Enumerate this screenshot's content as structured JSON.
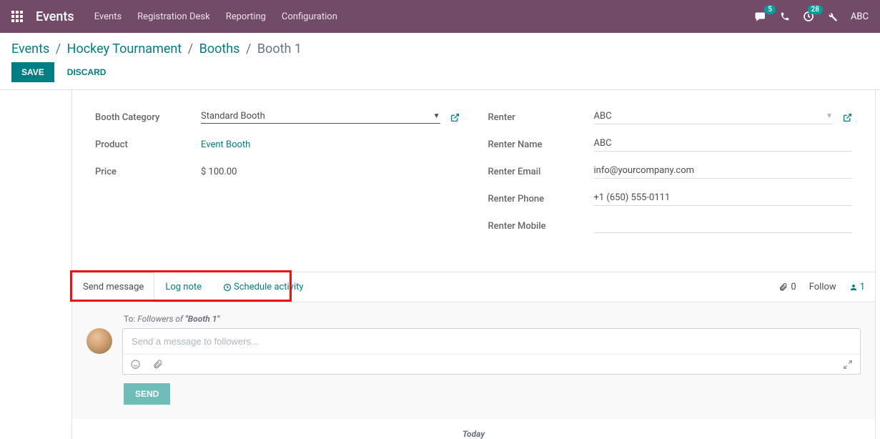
{
  "navbar": {
    "brand": "Events",
    "items": [
      "Events",
      "Registration Desk",
      "Reporting",
      "Configuration"
    ],
    "chat_badge": "5",
    "activity_badge": "28",
    "user": "ABC"
  },
  "breadcrumb": {
    "root": "Events",
    "event": "Hockey Tournament",
    "section": "Booths",
    "current": "Booth 1"
  },
  "actions": {
    "save": "SAVE",
    "discard": "DISCARD"
  },
  "form": {
    "left": {
      "booth_category_label": "Booth Category",
      "booth_category_value": "Standard Booth",
      "product_label": "Product",
      "product_value": "Event Booth",
      "price_label": "Price",
      "price_value": "$ 100.00"
    },
    "right": {
      "renter_label": "Renter",
      "renter_value": "ABC",
      "renter_name_label": "Renter Name",
      "renter_name_value": "ABC",
      "renter_email_label": "Renter Email",
      "renter_email_value": "info@yourcompany.com",
      "renter_phone_label": "Renter Phone",
      "renter_phone_value": "+1 (650) 555-0111",
      "renter_mobile_label": "Renter Mobile",
      "renter_mobile_value": ""
    }
  },
  "chatter": {
    "tabs": {
      "send_message": "Send message",
      "log_note": "Log note",
      "schedule_activity": "Schedule activity"
    },
    "attachments": "0",
    "follow": "Follow",
    "followers": "1",
    "compose": {
      "to_prefix": "To:",
      "to_text": "Followers of ",
      "to_record": "\"Booth 1\"",
      "placeholder": "Send a message to followers...",
      "send": "SEND"
    },
    "today": "Today"
  }
}
